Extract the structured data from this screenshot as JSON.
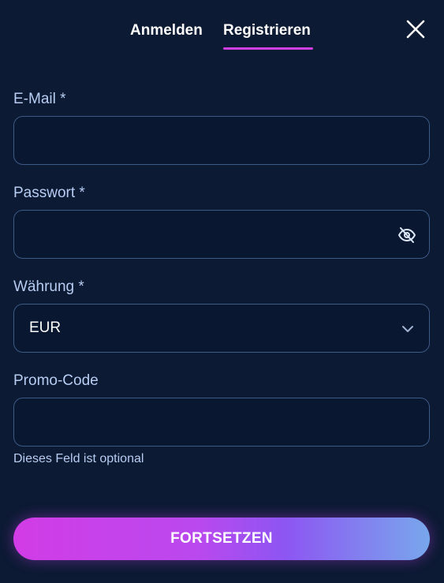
{
  "tabs": {
    "login_label": "Anmelden",
    "register_label": "Registrieren",
    "active": "register"
  },
  "icons": {
    "close": "close-icon",
    "password_toggle": "eye-off-icon",
    "select_arrow": "chevron-down-icon"
  },
  "form": {
    "email": {
      "label": "E-Mail *",
      "value": "",
      "placeholder": ""
    },
    "password": {
      "label": "Passwort *",
      "value": "",
      "placeholder": ""
    },
    "currency": {
      "label": "Währung *",
      "selected": "EUR"
    },
    "promo": {
      "label": "Promo-Code",
      "value": "",
      "placeholder": "",
      "helper": "Dieses Feld ist optional"
    }
  },
  "submit_label": "FORTSETZEN",
  "colors": {
    "background": "#0c1a33",
    "accent": "#d03fe0",
    "label": "#b7cdf3",
    "border": "#3c5a86",
    "button_gradient_start": "#d23ce6",
    "button_gradient_end": "#78a7ec"
  }
}
